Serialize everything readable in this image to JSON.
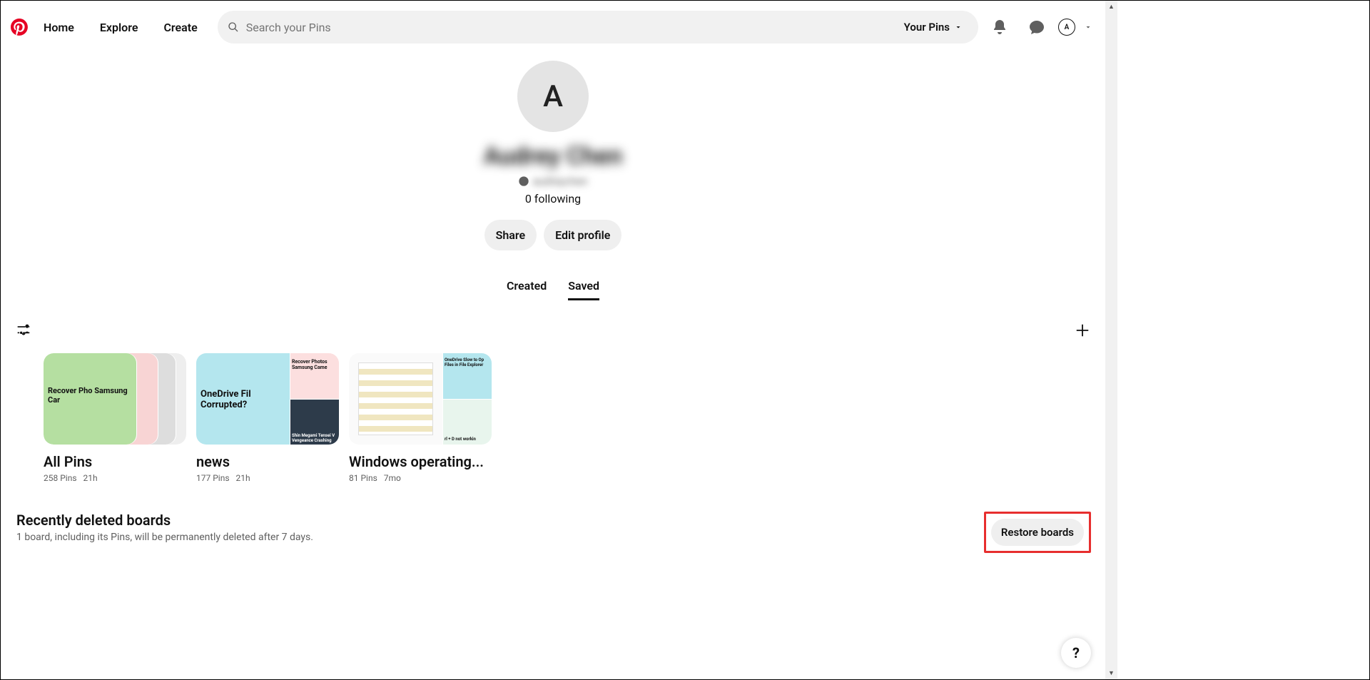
{
  "header": {
    "nav": {
      "home": "Home",
      "explore": "Explore",
      "create": "Create"
    },
    "search_placeholder": "Search your Pins",
    "filter_pill": "Your Pins",
    "avatar_letter": "A"
  },
  "profile": {
    "avatar_letter": "A",
    "name": "Audrey Chen",
    "handle": "audreychen",
    "following": "0 following",
    "buttons": {
      "share": "Share",
      "edit": "Edit profile"
    },
    "tabs": {
      "created": "Created",
      "saved": "Saved"
    }
  },
  "boards": [
    {
      "name": "All Pins",
      "pins": "258 Pins",
      "time": "21h",
      "thumb_text": "Recover Pho Samsung Car"
    },
    {
      "name": "news",
      "pins": "177 Pins",
      "time": "21h",
      "thumb_text": "OneDrive Fil Corrupted?",
      "side1": "Recover Photos Samsung Came",
      "side2": "Shin Megami Tensei V Vengeance Crashing"
    },
    {
      "name": "Windows operating...",
      "pins": "81 Pins",
      "time": "7mo",
      "side1": "OneDrive Slow to Op Files in File Explorer",
      "side2": "rl + D not workin"
    }
  ],
  "deleted": {
    "title": "Recently deleted boards",
    "subtitle": "1 board, including its Pins, will be permanently deleted after 7 days.",
    "restore": "Restore boards"
  },
  "help": "?"
}
